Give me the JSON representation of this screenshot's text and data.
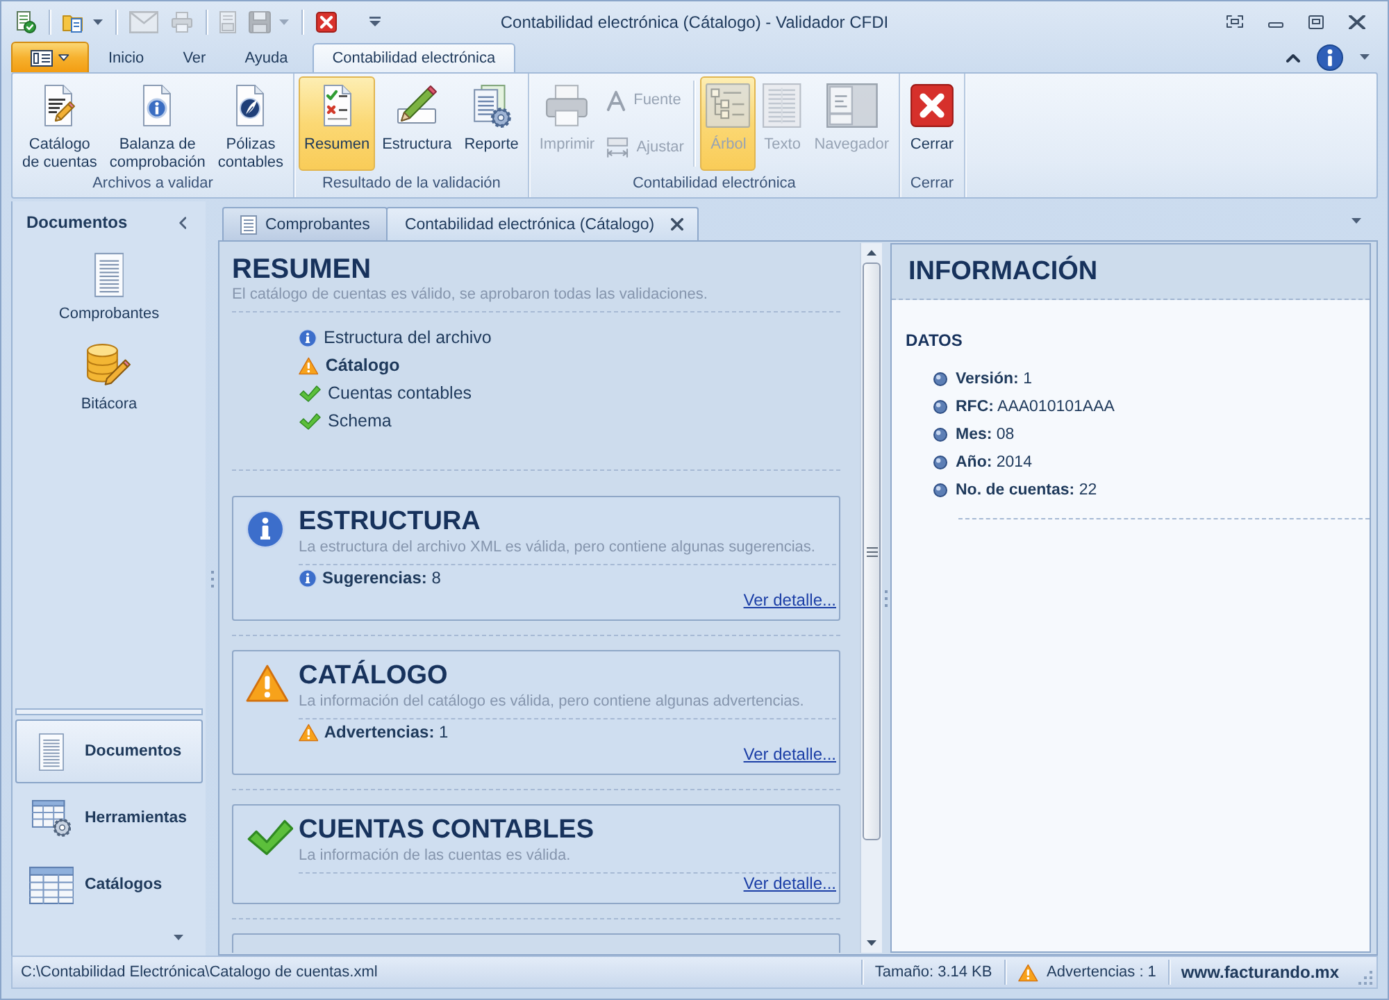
{
  "window": {
    "title": "Contabilidad electrónica (Cátalogo) - Validador CFDI"
  },
  "quick_access": [
    [
      {
        "disabled": false,
        "menu": false
      }
    ],
    [
      {
        "disabled": false,
        "menu": true
      }
    ],
    [
      {
        "disabled": true,
        "menu": false
      },
      {
        "disabled": true,
        "menu": false
      }
    ],
    [
      {
        "disabled": true,
        "menu": false
      },
      {
        "disabled": true,
        "menu": true
      }
    ],
    [
      {
        "disabled": false,
        "menu": false
      }
    ]
  ],
  "ribbon_tabs": [
    {
      "label": "Inicio",
      "selected": false
    },
    {
      "label": "Ver",
      "selected": false
    },
    {
      "label": "Ayuda",
      "selected": false
    },
    {
      "label": "Contabilidad electrónica",
      "selected": true
    }
  ],
  "ribbon_groups": [
    {
      "label": "Archivos a validar",
      "items": [
        {
          "kind": "large",
          "label": "Catálogo\nde cuentas",
          "selected": false,
          "disabled": false
        },
        {
          "kind": "large",
          "label": "Balanza de\ncomprobación",
          "selected": false,
          "disabled": false
        },
        {
          "kind": "large",
          "label": "Pólizas\ncontables",
          "selected": false,
          "disabled": false
        }
      ]
    },
    {
      "label": "Resultado de la validación",
      "items": [
        {
          "kind": "large",
          "label": "Resumen",
          "selected": true,
          "disabled": false
        },
        {
          "kind": "large",
          "label": "Estructura",
          "selected": false,
          "disabled": false
        },
        {
          "kind": "large",
          "label": "Reporte",
          "selected": false,
          "disabled": false
        }
      ]
    },
    {
      "label": "Contabilidad electrónica",
      "items": [
        {
          "kind": "large",
          "label": "Imprimir",
          "selected": false,
          "disabled": true
        },
        {
          "kind": "stack",
          "buttons": [
            {
              "label": "Fuente",
              "disabled": true
            },
            {
              "label": "Ajustar",
              "disabled": true
            }
          ]
        },
        {
          "kind": "separator"
        },
        {
          "kind": "large",
          "label": "Árbol",
          "selected": true,
          "disabled": true
        },
        {
          "kind": "large",
          "label": "Texto",
          "selected": false,
          "disabled": true
        },
        {
          "kind": "large",
          "label": "Navegador",
          "selected": false,
          "disabled": true
        }
      ]
    },
    {
      "label": "Cerrar",
      "items": [
        {
          "kind": "large",
          "label": "Cerrar",
          "selected": false,
          "disabled": false
        }
      ]
    }
  ],
  "sidebar": {
    "title": "Documentos",
    "items": [
      {
        "label": "Comprobantes",
        "selected": false
      },
      {
        "label": "Bitácora",
        "selected": false
      }
    ],
    "navigation": [
      {
        "label": "Documentos",
        "selected": true
      },
      {
        "label": "Herramientas",
        "selected": false
      },
      {
        "label": "Catálogos",
        "selected": false
      }
    ]
  },
  "document_tabs": [
    {
      "label": "Comprobantes",
      "selected": false,
      "closable": false
    },
    {
      "label": "Contabilidad electrónica (Cátalogo)",
      "selected": true,
      "closable": true
    }
  ],
  "summary": {
    "title": "RESUMEN",
    "subtitle": "El catálogo de cuentas es válido, se aprobaron todas las validaciones.",
    "items": [
      {
        "label": "Estructura del archivo",
        "kind": "info",
        "emphasized": false
      },
      {
        "label": "Cátalogo",
        "kind": "warning",
        "emphasized": true
      },
      {
        "label": "Cuentas contables",
        "kind": "ok",
        "emphasized": false
      },
      {
        "label": "Schema",
        "kind": "ok",
        "emphasized": false
      }
    ]
  },
  "cards": [
    {
      "title": "ESTRUCTURA",
      "kind": "info",
      "description": "La estructura del archivo XML es válida, pero contiene algunas sugerencias.",
      "count": "**Sugerencias:** 8",
      "link": "Ver detalle..."
    },
    {
      "title": "CATÁLOGO",
      "kind": "warning",
      "description": "La información del catálogo es válida, pero contiene algunas advertencias.",
      "count": "**Advertencias:** 1",
      "link": "Ver detalle..."
    },
    {
      "title": "CUENTAS CONTABLES",
      "kind": "ok",
      "description": "La información de las cuentas es válida.",
      "link": "Ver detalle..."
    }
  ],
  "info_panel": {
    "title": "INFORMACIÓN",
    "section": "DATOS",
    "fields": [
      "**Versión:** 1",
      "**RFC:** AAA010101AAA",
      "**Mes:** 08",
      "**Año:** 2014",
      "**No. de cuentas:** 22"
    ]
  },
  "status_bar": {
    "path": "C:\\Contabilidad Electrónica\\Catalogo de cuentas.xml",
    "size": "Tamaño: 3.14 KB",
    "warnings": {
      "label": "Advertencias : 1",
      "kind": "warning"
    },
    "website": "www.facturando.mx"
  }
}
